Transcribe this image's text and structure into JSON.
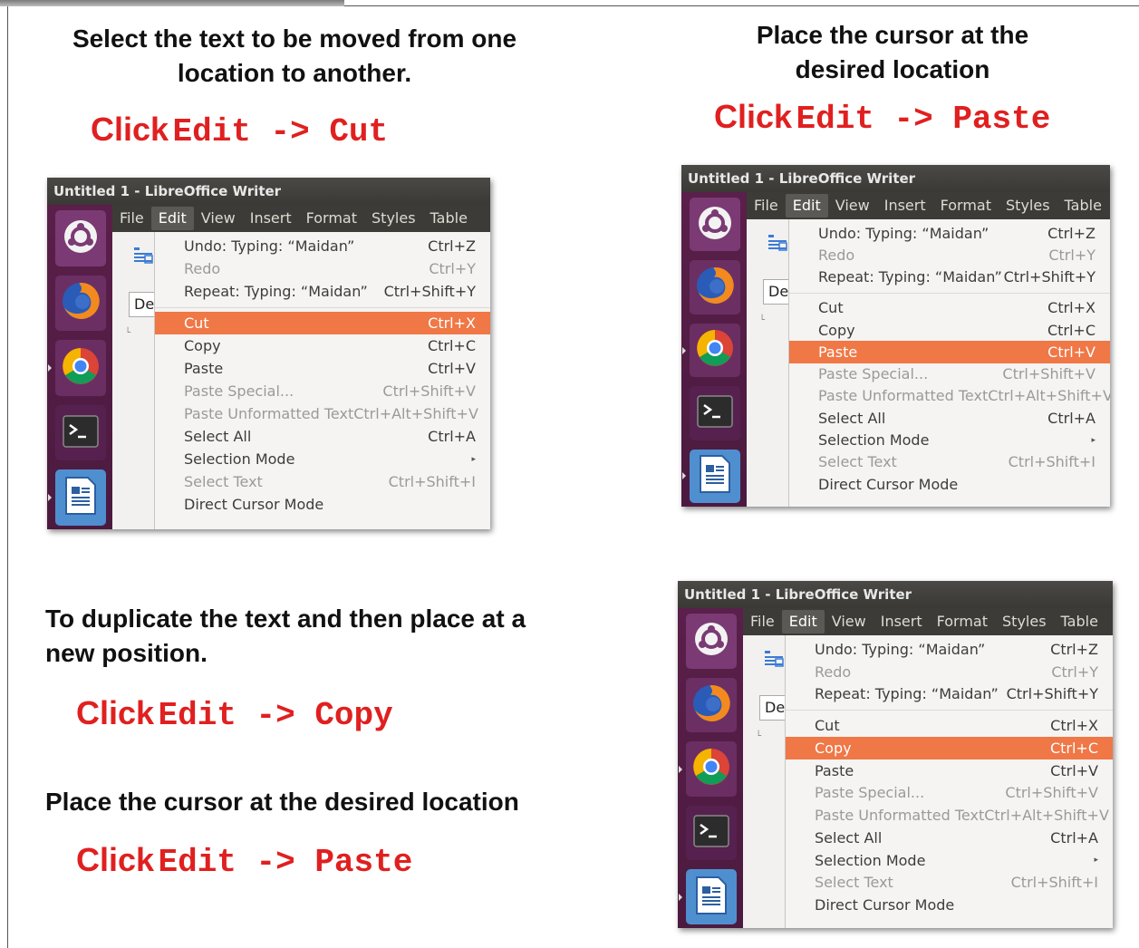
{
  "instructions": {
    "select_line1": "Select the text to be moved from one",
    "select_line2": "location to another.",
    "place_right_line1": "Place the cursor at the",
    "place_right_line2": "desired location",
    "duplicate_line1": "To duplicate the text and then place at a",
    "duplicate_line2": "new position.",
    "place_left": "Place the cursor at the desired location"
  },
  "commands": {
    "click_word": "Click",
    "cut": "Edit -> Cut",
    "paste": "Edit -> Paste",
    "copy": "Edit -> Copy"
  },
  "window": {
    "title": "Untitled 1 - LibreOffice Writer",
    "menubar": [
      "File",
      "Edit",
      "View",
      "Insert",
      "Format",
      "Styles",
      "Table"
    ],
    "active_menu": "Edit",
    "doc_field": "De",
    "launcher_icons": [
      "ubuntu-icon",
      "firefox-icon",
      "chrome-icon",
      "terminal-icon",
      "libreoffice-writer-icon"
    ]
  },
  "edit_menu": [
    {
      "label": "Undo: Typing: “Maidan”",
      "shortcut": "Ctrl+Z",
      "enabled": true
    },
    {
      "label": "Redo",
      "shortcut": "Ctrl+Y",
      "enabled": false
    },
    {
      "label": "Repeat: Typing: “Maidan”",
      "shortcut": "Ctrl+Shift+Y",
      "enabled": true
    },
    {
      "label": "Cut",
      "shortcut": "Ctrl+X",
      "enabled": true
    },
    {
      "label": "Copy",
      "shortcut": "Ctrl+C",
      "enabled": true
    },
    {
      "label": "Paste",
      "shortcut": "Ctrl+V",
      "enabled": true
    },
    {
      "label": "Paste Special...",
      "shortcut": "Ctrl+Shift+V",
      "enabled": false
    },
    {
      "label": "Paste Unformatted Text",
      "shortcut": "Ctrl+Alt+Shift+V",
      "enabled": false
    },
    {
      "label": "Select All",
      "shortcut": "Ctrl+A",
      "enabled": true
    },
    {
      "label": "Selection Mode",
      "shortcut": "",
      "enabled": true,
      "submenu": true
    },
    {
      "label": "Select Text",
      "shortcut": "Ctrl+Shift+I",
      "enabled": false
    },
    {
      "label": "Direct Cursor Mode",
      "shortcut": "",
      "enabled": true
    }
  ],
  "screenshots": [
    {
      "highlighted": "Cut"
    },
    {
      "highlighted": "Paste"
    },
    {
      "highlighted": "Copy"
    }
  ],
  "colors": {
    "highlight": "#f07746",
    "command_text": "#e02020",
    "titlebar": "#3c3b37",
    "launcher": "#4b1a3f"
  }
}
